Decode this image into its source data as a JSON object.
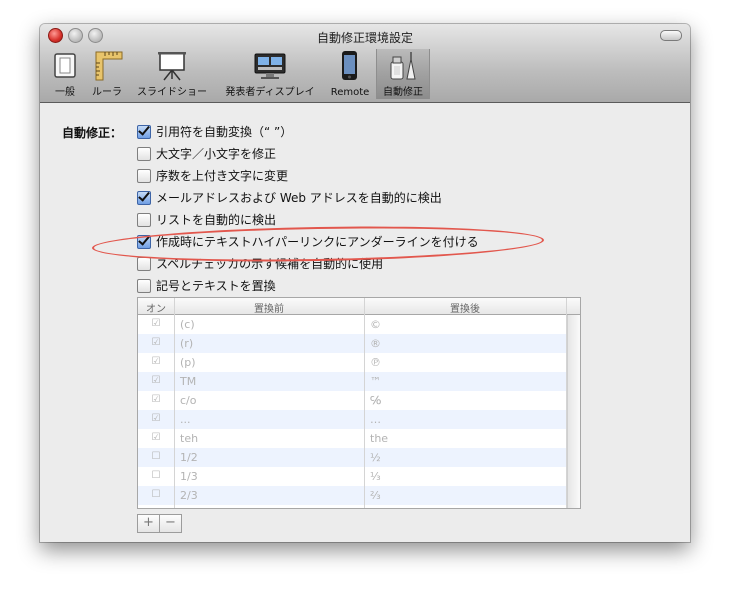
{
  "window": {
    "title": "自動修正環境設定"
  },
  "toolbar": {
    "items": [
      {
        "label": "一般",
        "icon": "general-icon"
      },
      {
        "label": "ルーラ",
        "icon": "ruler-icon"
      },
      {
        "label": "スライドショー",
        "icon": "slideshow-icon"
      },
      {
        "label": "発表者ディスプレイ",
        "icon": "presenter-display-icon"
      },
      {
        "label": "Remote",
        "icon": "iphone-remote-icon"
      },
      {
        "label": "自動修正",
        "icon": "autocorrect-icon",
        "selected": true
      }
    ]
  },
  "autocorrect": {
    "label": "自動修正：",
    "options": [
      {
        "label": "引用符を自動変換（“ ”）",
        "checked": true
      },
      {
        "label": "大文字／小文字を修正",
        "checked": false
      },
      {
        "label": "序数を上付き文字に変更",
        "checked": false
      },
      {
        "label": "メールアドレスおよび Web アドレスを自動的に検出",
        "checked": true
      },
      {
        "label": "リストを自動的に検出",
        "checked": false
      },
      {
        "label": "作成時にテキストハイパーリンクにアンダーラインを付ける",
        "checked": true,
        "highlighted": true
      },
      {
        "label": "スペルチェッカの示す候補を自動的に使用",
        "checked": false
      },
      {
        "label": "記号とテキストを置換",
        "checked": false
      }
    ]
  },
  "replacement_table": {
    "headers": {
      "on": "オン",
      "before": "置換前",
      "after": "置換後"
    },
    "rows": [
      {
        "on": "☑",
        "before": "(c)",
        "after": "©"
      },
      {
        "on": "☑",
        "before": "(r)",
        "after": "®"
      },
      {
        "on": "☑",
        "before": "(p)",
        "after": "℗"
      },
      {
        "on": "☑",
        "before": "TM",
        "after": "™"
      },
      {
        "on": "☑",
        "before": "c/o",
        "after": "℅"
      },
      {
        "on": "☑",
        "before": "...",
        "after": "…"
      },
      {
        "on": "☑",
        "before": "teh",
        "after": "the"
      },
      {
        "on": "☐",
        "before": "1/2",
        "after": "½"
      },
      {
        "on": "☐",
        "before": "1/3",
        "after": "⅓"
      },
      {
        "on": "☐",
        "before": "2/3",
        "after": "⅔"
      }
    ]
  },
  "buttons": {
    "add": "+",
    "remove": "−"
  },
  "colors": {
    "highlight_oval": "#e2574d",
    "checkbox_on": "#6f9ee4",
    "row_alt": "#edf3fe"
  }
}
